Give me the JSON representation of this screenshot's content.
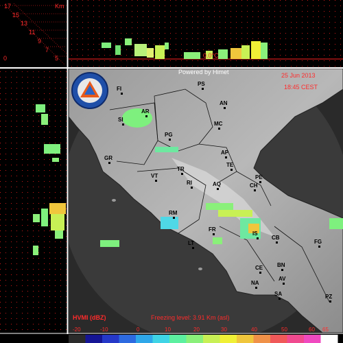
{
  "header": {
    "powered_by": "Powered by Himet",
    "date": "25 Jun 2013",
    "time": "18:45 CEST"
  },
  "logo": {
    "name": "protezione-civile-logo",
    "text": "protezione civile"
  },
  "height_scale": {
    "unit": "Km",
    "labels": [
      "17",
      "15",
      "13",
      "11",
      "9",
      "7",
      "5"
    ],
    "ground_label": "0"
  },
  "freezing_marker": "0.0°C",
  "footer": {
    "product": "HVMI (dBZ)",
    "freezing_level": "Freezing level: 3.91 Km (asl)"
  },
  "color_scale": {
    "labels": [
      "-20",
      "-10",
      "0",
      "10",
      "20",
      "30",
      "40",
      "50",
      "60",
      "65"
    ],
    "colors": [
      "#2a2a2a",
      "#151595",
      "#2538c8",
      "#2d6ae0",
      "#2ea7e9",
      "#3fd4e6",
      "#5cf0a0",
      "#8af07a",
      "#c8f055",
      "#f0f036",
      "#f0c63c",
      "#f09148",
      "#f05959",
      "#f04a8f",
      "#f04ac0",
      "#ffffff"
    ]
  },
  "city_labels": [
    {
      "code": "FI"
    },
    {
      "code": "PS"
    },
    {
      "code": "AN"
    },
    {
      "code": "AR"
    },
    {
      "code": "SI"
    },
    {
      "code": "MC"
    },
    {
      "code": "PG"
    },
    {
      "code": "AP"
    },
    {
      "code": "GR"
    },
    {
      "code": "TE"
    },
    {
      "code": "TR"
    },
    {
      "code": "PE"
    },
    {
      "code": "VT"
    },
    {
      "code": "RI"
    },
    {
      "code": "AQ"
    },
    {
      "code": "CH"
    },
    {
      "code": "RM"
    },
    {
      "code": "FR"
    },
    {
      "code": "IS"
    },
    {
      "code": "CB"
    },
    {
      "code": "LT"
    },
    {
      "code": "FG"
    },
    {
      "code": "CE"
    },
    {
      "code": "BN"
    },
    {
      "code": "AV"
    },
    {
      "code": "NA"
    },
    {
      "code": "SA"
    },
    {
      "code": "PZ"
    }
  ]
}
